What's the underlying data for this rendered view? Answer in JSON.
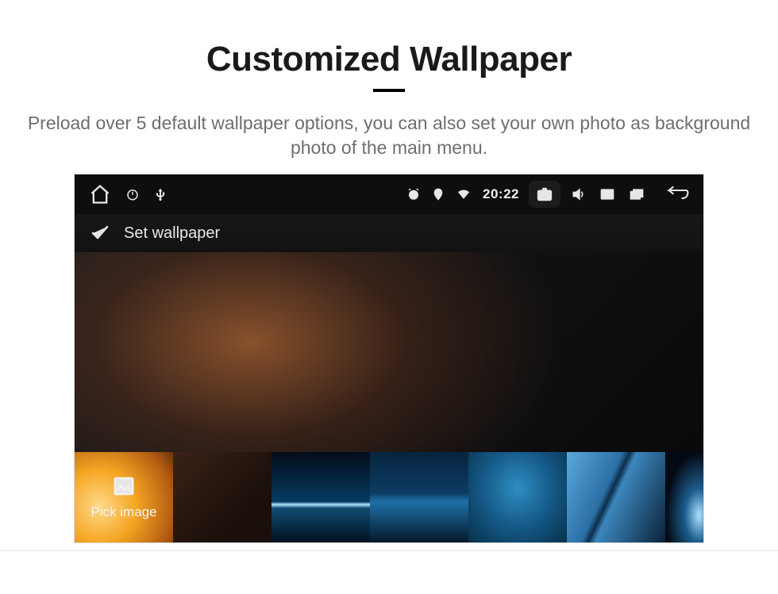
{
  "page": {
    "title": "Customized Wallpaper",
    "subtitle": "Preload over 5 default wallpaper options, you can also set your own photo as background photo of the main menu."
  },
  "statusbar": {
    "time": "20:22"
  },
  "action": {
    "label": "Set wallpaper"
  },
  "thumb_strip": {
    "pick_label": "Pick image"
  }
}
